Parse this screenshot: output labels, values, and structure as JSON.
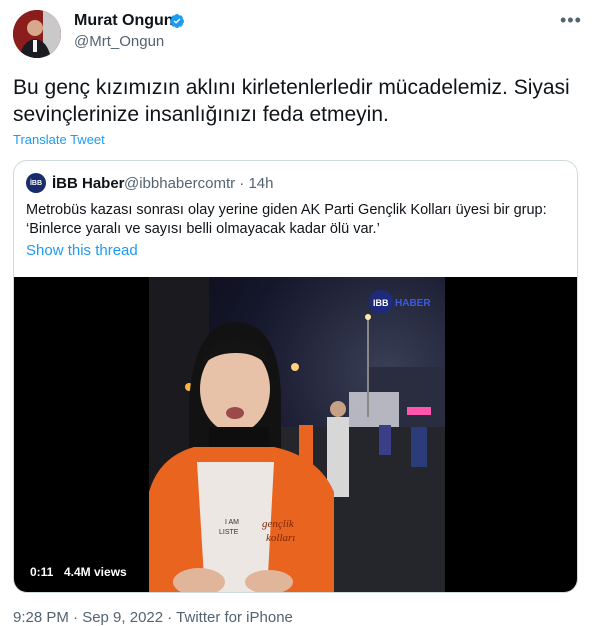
{
  "author": {
    "name": "Murat Ongun",
    "handle": "@Mrt_Ongun"
  },
  "tweet": {
    "text": "Bu genç kızımızın aklını kirletenlerledir mücadelemiz. Siyasi sevinçlerinize insanlığınızı feda etmeyin.",
    "translate_label": "Translate Tweet"
  },
  "quote": {
    "name": "İBB Haber",
    "handle": "@ibbhabercomtr",
    "time": "· 14h",
    "text": "Metrobüs kazası sonrası olay yerine giden AK Parti Gençlik Kolları üyesi bir grup: ‘Binlerce yaralı ve sayısı belli olmayacak kadar ölü var.’",
    "show_thread": "Show this thread",
    "video": {
      "duration": "0:11",
      "views": "4.4M views",
      "watermark": "IBBHABER",
      "shirt_text": "I AM ... LISTE...",
      "vest_logo": "gençlik kolları"
    }
  },
  "footer": {
    "timestamp": "9:28 PM · Sep 9, 2022 · Twitter for iPhone"
  },
  "colors": {
    "link": "#1d9bf0",
    "secondary_text": "#536471",
    "vest": "#e8641f"
  }
}
